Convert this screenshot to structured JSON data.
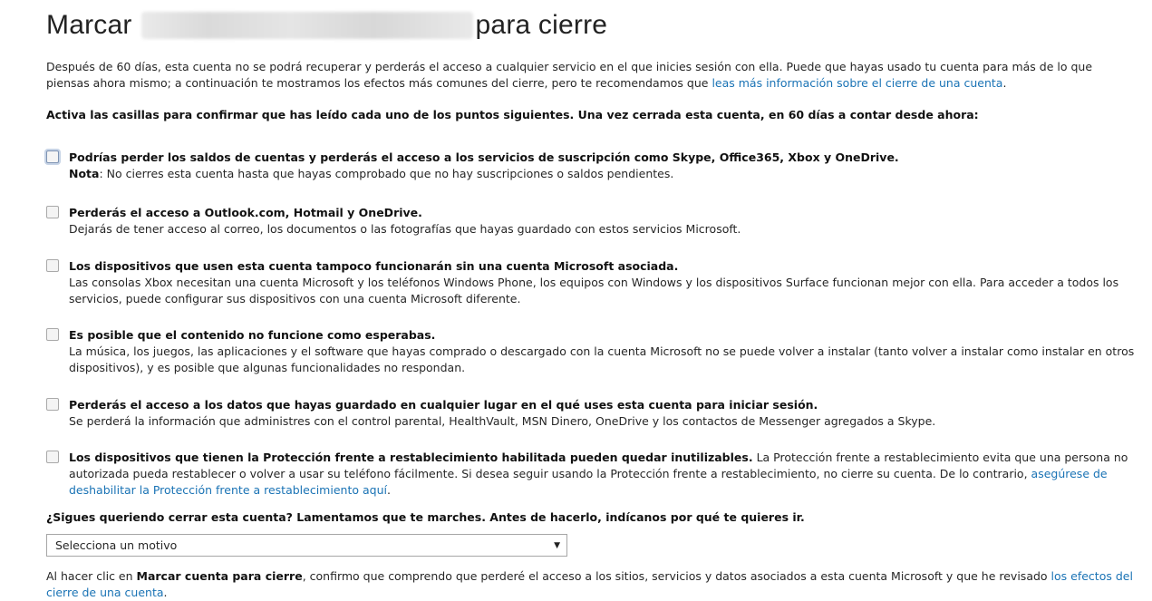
{
  "title": {
    "prefix": "Marcar",
    "suffix": "para cierre"
  },
  "intro": {
    "text": "Después de 60 días, esta cuenta no se podrá recuperar y perderás el acceso a cualquier servicio en el que inicies sesión con ella. Puede que hayas usado tu cuenta para más de lo que piensas ahora mismo; a continuación te mostramos los efectos más comunes del cierre, pero te recomendamos que ",
    "link": "leas más información sobre el cierre de una cuenta",
    "end": "."
  },
  "instructions": "Activa las casillas para confirmar que has leído cada uno de los puntos siguientes. Una vez cerrada esta cuenta, en 60 días a contar desde ahora:",
  "items": [
    {
      "head": "Podrías perder los saldos de cuentas y perderás el acceso a los servicios de suscripción como Skype, Office365, Xbox y OneDrive.",
      "note_label": "Nota",
      "note": ": No cierres esta cuenta hasta que hayas comprobado que no hay suscripciones o saldos pendientes."
    },
    {
      "head": "Perderás el acceso a Outlook.com, Hotmail y OneDrive.",
      "body": "Dejarás de tener acceso al correo, los documentos o las fotografías que hayas guardado con estos servicios Microsoft."
    },
    {
      "head": "Los dispositivos que usen esta cuenta tampoco funcionarán sin una cuenta Microsoft asociada.",
      "body": "Las consolas Xbox necesitan una cuenta Microsoft y los teléfonos Windows Phone, los equipos con Windows y los dispositivos Surface funcionan mejor con ella. Para acceder a todos los servicios, puede configurar sus dispositivos con una cuenta Microsoft diferente."
    },
    {
      "head": "Es posible que el contenido no funcione como esperabas.",
      "body": "La música, los juegos, las aplicaciones y el software que hayas comprado o descargado con la cuenta Microsoft no se puede volver a instalar (tanto volver a instalar como instalar en otros dispositivos), y es posible que algunas funcionalidades no respondan."
    },
    {
      "head": "Perderás el acceso a los datos que hayas guardado en cualquier lugar en el qué uses esta cuenta para iniciar sesión.",
      "body": "Se perderá la información que administres con el control parental, HealthVault, MSN Dinero, OneDrive y los contactos de Messenger agregados a Skype."
    },
    {
      "head": "Los dispositivos que tienen la Protección frente a restablecimiento habilitada pueden quedar inutilizables.",
      "body": " La Protección frente a restablecimiento evita que una persona no autorizada pueda restablecer o volver a usar su teléfono fácilmente. Si desea seguir usando la Protección frente a restablecimiento, no cierre su cuenta. De lo contrario, ",
      "link": "asegúrese de deshabilitar la Protección frente a restablecimiento aquí",
      "end": "."
    }
  ],
  "question": "¿Sigues queriendo cerrar esta cuenta? Lamentamos que te marches. Antes de hacerlo, indícanos por qué te quieres ir.",
  "reason_select": {
    "selected": "Selecciona un motivo",
    "arrow": "▼"
  },
  "footer": {
    "pre": "Al hacer clic en ",
    "bold": "Marcar cuenta para cierre",
    "mid": ", confirmo que comprendo que perderé el acceso a los sitios, servicios y datos asociados a esta cuenta Microsoft y que he revisado ",
    "link": "los efectos del cierre de una cuenta",
    "end": "."
  }
}
